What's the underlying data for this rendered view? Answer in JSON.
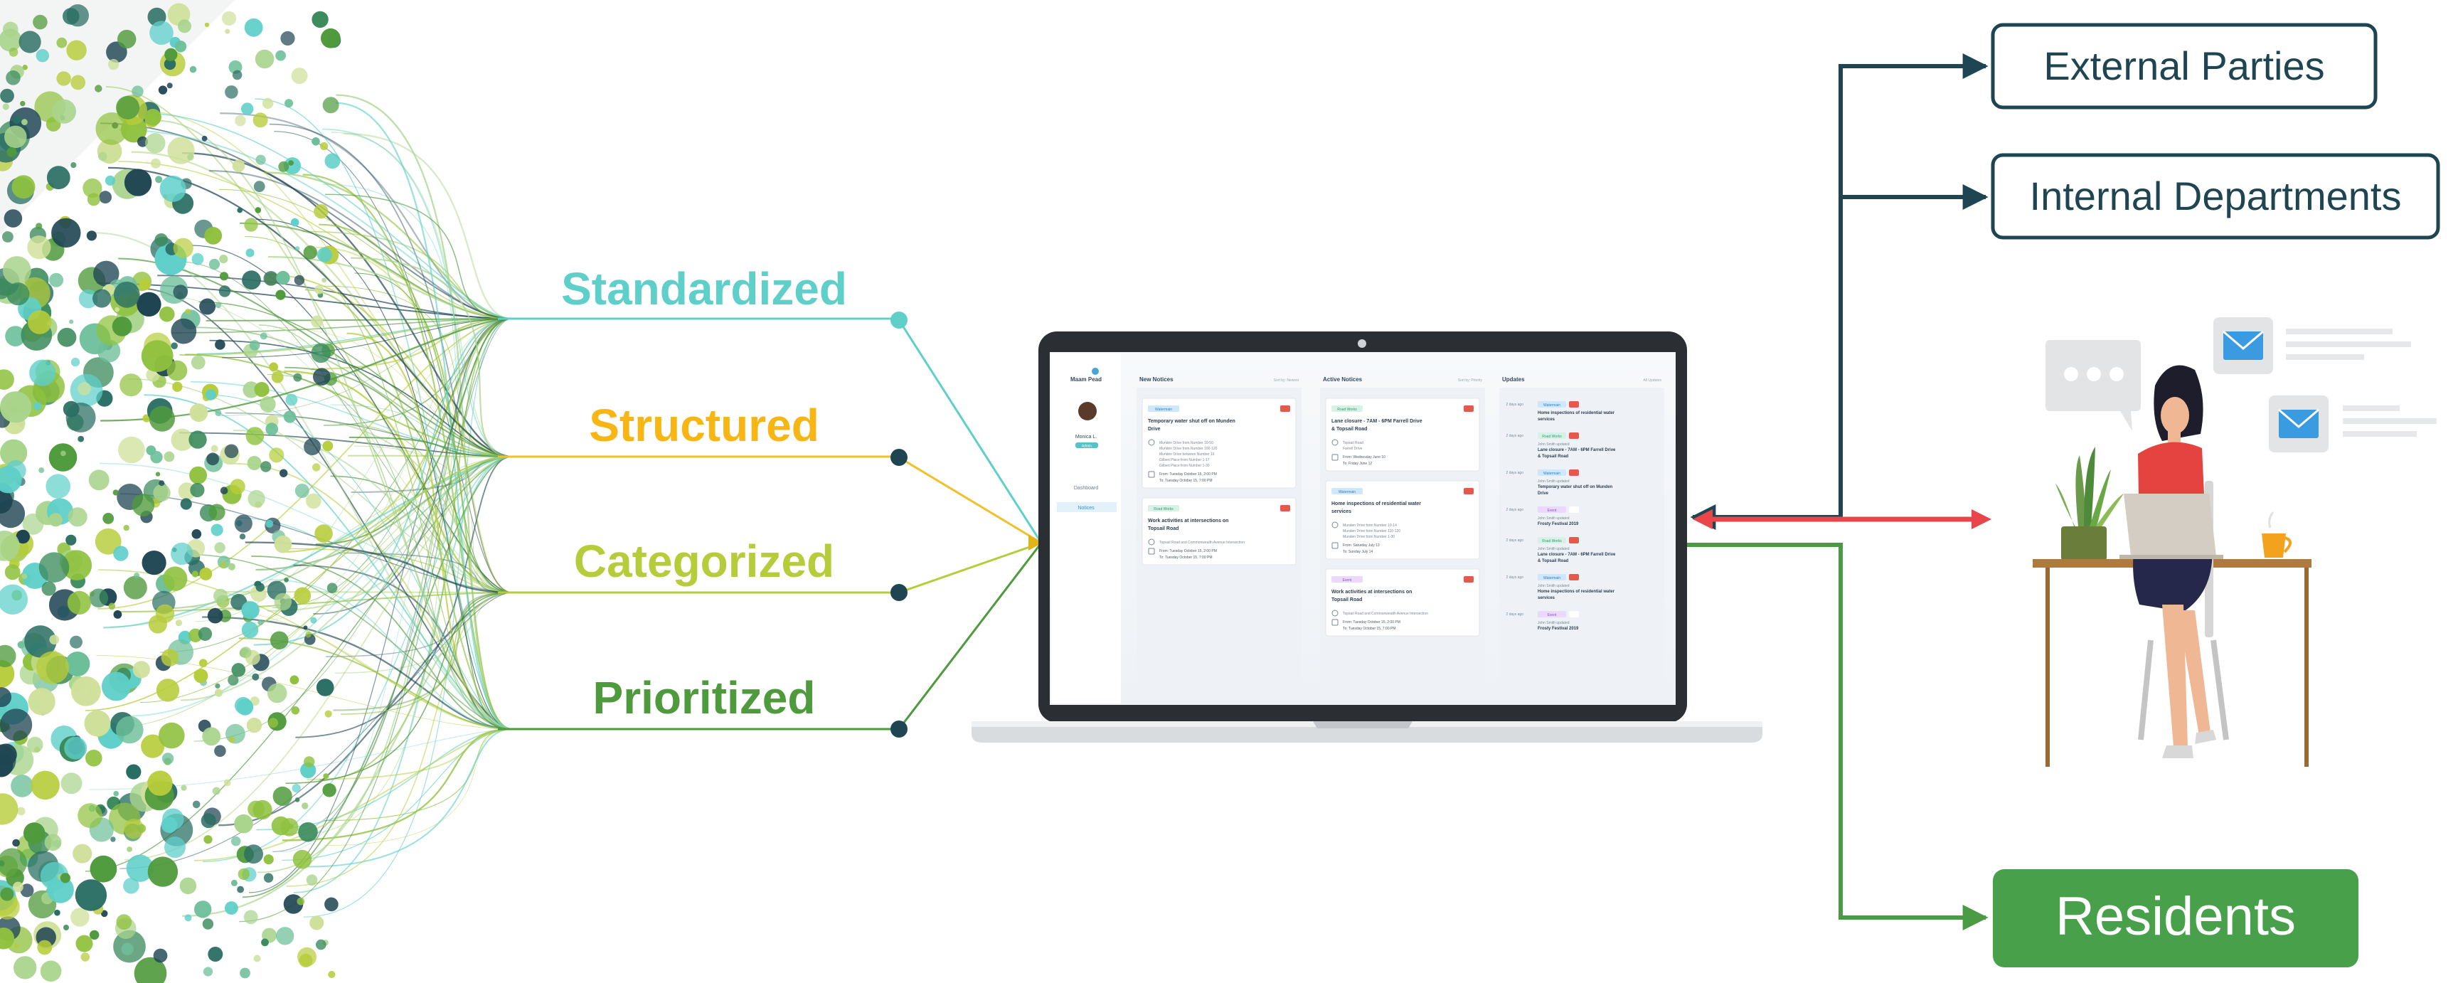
{
  "stages": [
    {
      "label": "Standardized",
      "color": "#5ecfc9"
    },
    {
      "label": "Structured",
      "color": "#f7b614"
    },
    {
      "label": "Categorized",
      "color": "#b7cc3a"
    },
    {
      "label": "Prioritized",
      "color": "#4f9a3c"
    }
  ],
  "recipients": {
    "external": "External Parties",
    "internal": "Internal Departments",
    "residents": "Residents"
  },
  "colors": {
    "dark": "#1f4553",
    "red": "#e8464b",
    "green": "#4a9b44",
    "residents_fill": "#48a14a"
  },
  "app": {
    "brand": "Maam Pead",
    "user": "Monica L.",
    "role": "Admin",
    "nav": [
      "Dashboard",
      "Notices"
    ],
    "columns": [
      {
        "title": "New Notices",
        "meta": "Sort by: Newest",
        "cards": [
          {
            "tag": "Watermain",
            "title": "Temporary water shut off on Munden Drive",
            "lines": [
              "Munden Drive from Number 10-50",
              "Munden Drive from Number 100-120",
              "Munden Drive between Number 16",
              "Gilbert Place from Number 1-17",
              "Gilbert Place from Number 1-30"
            ],
            "from": "From: Tuesday October 15, 2:00 PM",
            "to": "To: Tuesday October 15, 7:00 PM"
          },
          {
            "tag": "Road Works",
            "title": "Work activities at intersections on Topsail Road",
            "lines": [
              "Topsail Road and Commonwealth Avenue Intersection"
            ],
            "from": "From: Tuesday October 15, 2:00 PM",
            "to": "To: Tuesday October 15, 7:00 PM"
          }
        ]
      },
      {
        "title": "Active Notices",
        "meta": "Sort by: Priority",
        "cards": [
          {
            "tag": "Road Works",
            "title": "Lane closure - 7AM - 6PM Farrell Drive & Topsail Road",
            "lines": [
              "Topsail Road",
              "Farrell Drive"
            ],
            "from": "From: Wednesday June 10",
            "to": "To: Friday June 12"
          },
          {
            "tag": "Watermain",
            "title": "Home inspections of residential water services",
            "lines": [
              "Munden Drive from Number 10-14",
              "Munden Drive from Number 110-120",
              "Munden Drive from Number 1-30"
            ],
            "from": "From: Saturday July 13",
            "to": "To: Sunday July 14"
          },
          {
            "tag": "Event",
            "title": "Work activities at intersections on Topsail Road",
            "lines": [
              "Topsail Road and Commonwealth Avenue Intersection"
            ],
            "from": "From: Tuesday October 15, 2:00 PM",
            "to": "To: Tuesday October 15, 7:00 PM"
          }
        ]
      },
      {
        "title": "Updates",
        "meta": "All Updates",
        "items": [
          {
            "when": "2 days ago",
            "tag": "Watermain",
            "who": "",
            "title": "Home inspections of residential water services"
          },
          {
            "when": "2 days ago",
            "tag": "Road Works",
            "who": "John Smith updated",
            "title": "Lane closure - 7AM - 6PM Farrell Drive & Topsail Road"
          },
          {
            "when": "2 days ago",
            "tag": "Watermain",
            "who": "John Smith updated",
            "title": "Temporary water shut off on Munden Drive"
          },
          {
            "when": "2 days ago",
            "tag": "Event",
            "who": "John Smith updated",
            "title": "Frosty Festival 2019"
          },
          {
            "when": "2 days ago",
            "tag": "Road Works",
            "who": "John Smith updated",
            "title": "Lane closure - 7AM - 6PM Farrell Drive & Topsail Road"
          },
          {
            "when": "2 days ago",
            "tag": "Watermain",
            "who": "John Smith updated",
            "title": "Home inspections of residential water services"
          },
          {
            "when": "2 days ago",
            "tag": "Event",
            "who": "John Smith updated",
            "title": "Frosty Festival 2019"
          }
        ]
      }
    ]
  }
}
